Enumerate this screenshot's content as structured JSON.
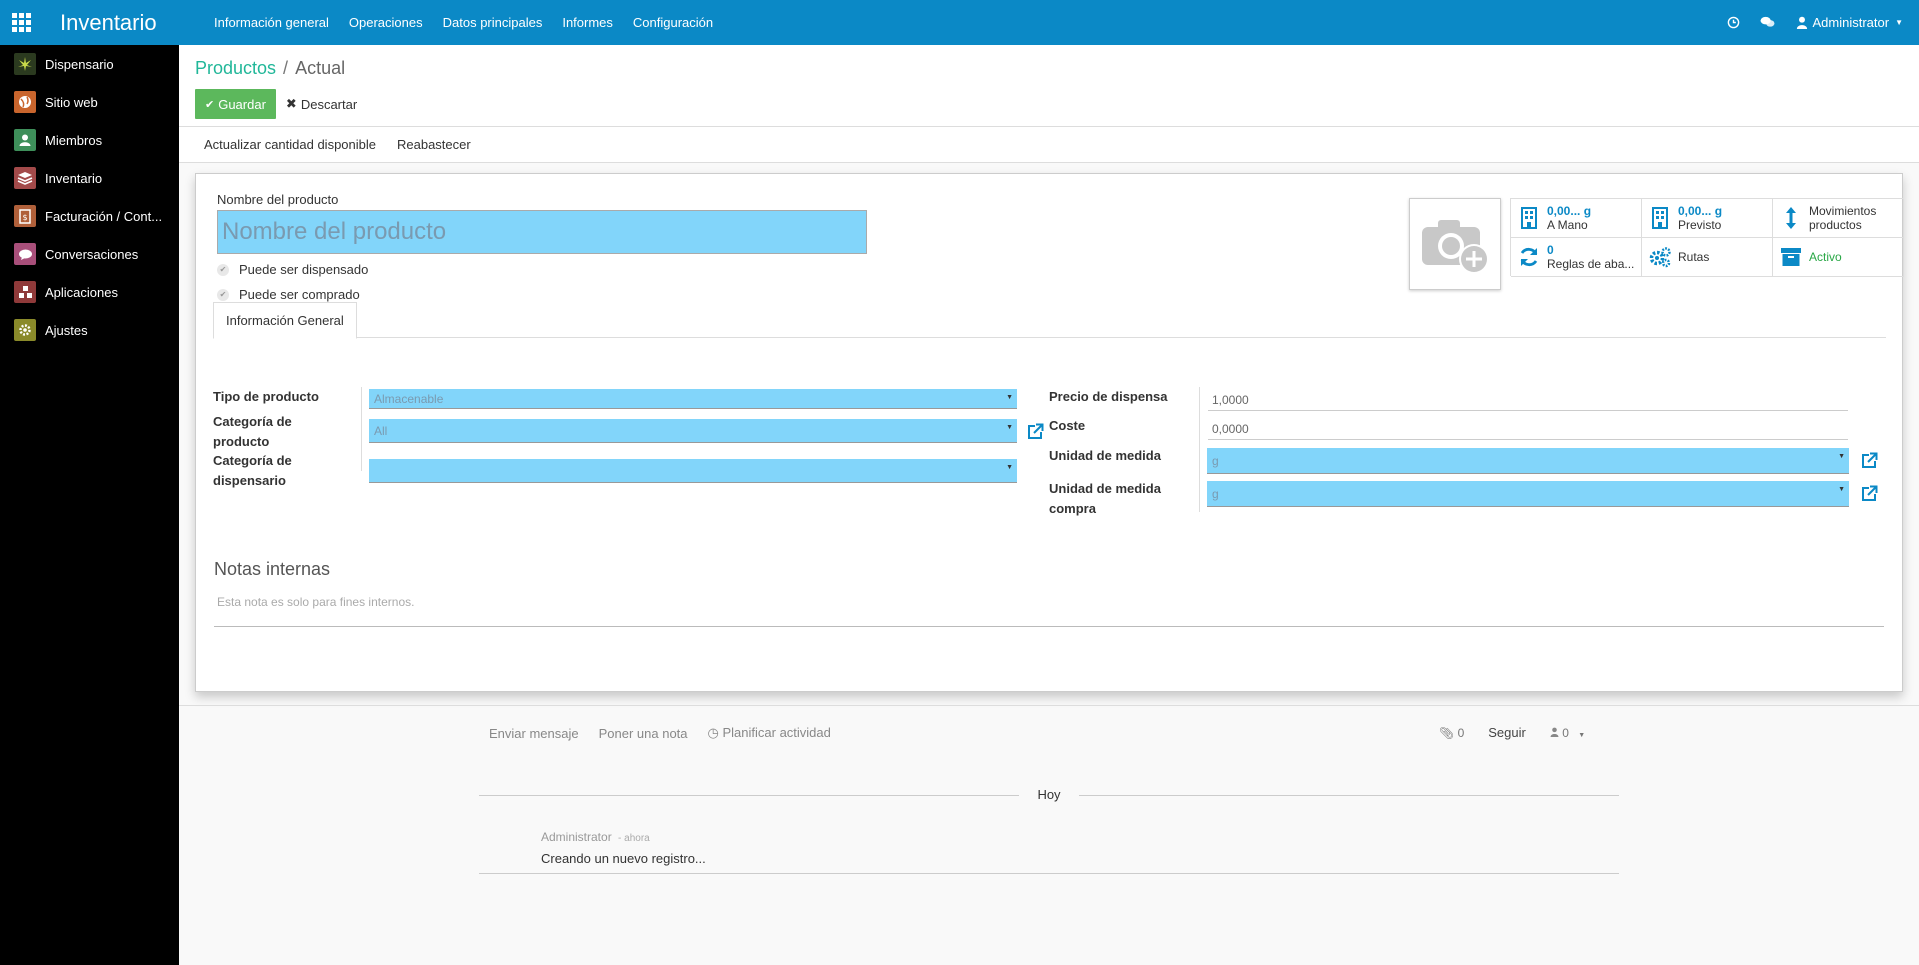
{
  "app": {
    "title": "Inventario",
    "menu": [
      "Información general",
      "Operaciones",
      "Datos principales",
      "Informes",
      "Configuración"
    ],
    "user": "Administrator"
  },
  "sidebar": {
    "items": [
      {
        "label": "Dispensario",
        "color": "#2b3a1f"
      },
      {
        "label": "Sitio web",
        "color": "#c9652d"
      },
      {
        "label": "Miembros",
        "color": "#3e8f5a"
      },
      {
        "label": "Inventario",
        "color": "#a34a4a"
      },
      {
        "label": "Facturación / Cont...",
        "color": "#b0603a"
      },
      {
        "label": "Conversaciones",
        "color": "#a84f7a"
      },
      {
        "label": "Aplicaciones",
        "color": "#8f3a3a"
      },
      {
        "label": "Ajustes",
        "color": "#8a8a2a"
      }
    ]
  },
  "breadcrumb": {
    "parent": "Productos",
    "separator": "/",
    "current": "Actual"
  },
  "buttons": {
    "save": "Guardar",
    "discard": "Descartar"
  },
  "status_buttons": [
    "Actualizar cantidad disponible",
    "Reabastecer"
  ],
  "form": {
    "name_label": "Nombre del producto",
    "name_placeholder": "Nombre del producto",
    "checkbox_dispensed": "Puede ser dispensado",
    "checkbox_purchased": "Puede ser comprado",
    "tab_general": "Información General",
    "product_type_label": "Tipo de producto",
    "product_type_value": "Almacenable",
    "category_label": "Categoría de producto",
    "category_value": "All",
    "dispensary_category_label": "Categoría de dispensario",
    "dispensary_category_value": "",
    "price_label": "Precio de dispensa",
    "price_value": "1,0000",
    "cost_label": "Coste",
    "cost_value": "0,0000",
    "uom_label": "Unidad de medida",
    "uom_value": "g",
    "uom_purchase_label": "Unidad de medida compra",
    "uom_purchase_value": "g",
    "notes_title": "Notas internas",
    "notes_placeholder": "Esta nota es solo para fines internos."
  },
  "smart_buttons": {
    "on_hand_value": "0,00... g",
    "on_hand_label": "A Mano",
    "forecast_value": "0,00... g",
    "forecast_label": "Previsto",
    "moves_label_1": "Movimientos",
    "moves_label_2": "productos",
    "rules_value": "0",
    "rules_label": "Reglas de aba...",
    "routes_label": "Rutas",
    "active_label": "Activo"
  },
  "chatter": {
    "send_message": "Enviar mensaje",
    "log_note": "Poner una nota",
    "schedule_activity": "Planificar actividad",
    "attachments_count": "0",
    "follow": "Seguir",
    "followers_count": "0",
    "today": "Hoy",
    "message_author": "Administrator",
    "message_time": "- ahora",
    "message_body": "Creando un nuevo registro..."
  },
  "colors": {
    "navbar": "#0b89c6",
    "save_button": "#5cb85c",
    "breadcrumb_link": "#21b799",
    "required_field": "#82d5fa"
  }
}
